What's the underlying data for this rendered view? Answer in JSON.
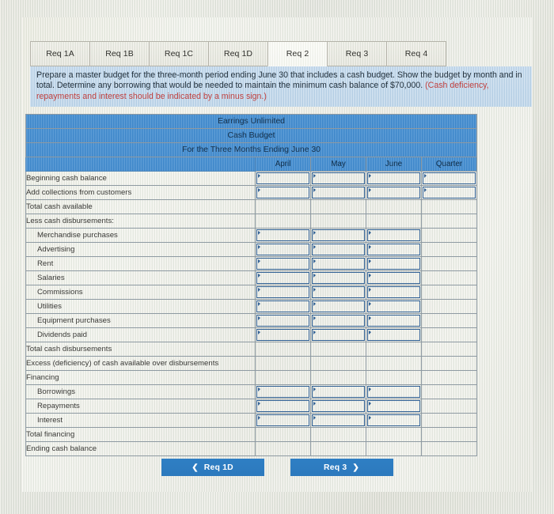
{
  "tabs": [
    {
      "label": "Req 1A",
      "active": false
    },
    {
      "label": "Req 1B",
      "active": false
    },
    {
      "label": "Req 1C",
      "active": false
    },
    {
      "label": "Req 1D",
      "active": false
    },
    {
      "label": "Req 2",
      "active": true
    },
    {
      "label": "Req 3",
      "active": false
    },
    {
      "label": "Req 4",
      "active": false
    }
  ],
  "instructions": {
    "main": "Prepare a master budget for the three-month period ending June 30 that includes a cash budget. Show the budget by month and in total. Determine any borrowing that would be needed to maintain the minimum cash balance of $70,000.",
    "hint": "(Cash deficiency, repayments and interest should be indicated by a minus sign.)"
  },
  "table": {
    "title_line1": "Earrings Unlimited",
    "title_line2": "Cash Budget",
    "title_line3": "For the Three Months Ending June 30",
    "columns": [
      "April",
      "May",
      "June",
      "Quarter"
    ],
    "rows": [
      {
        "label": "Beginning cash balance",
        "indent": false,
        "inputs": [
          true,
          true,
          true,
          true
        ]
      },
      {
        "label": "Add collections from customers",
        "indent": false,
        "inputs": [
          true,
          true,
          true,
          true
        ]
      },
      {
        "label": "Total cash available",
        "indent": false,
        "inputs": [
          false,
          false,
          false,
          false
        ]
      },
      {
        "label": "Less cash disbursements:",
        "indent": false,
        "inputs": [
          false,
          false,
          false,
          false
        ]
      },
      {
        "label": "Merchandise purchases",
        "indent": true,
        "inputs": [
          true,
          true,
          true,
          false
        ]
      },
      {
        "label": "Advertising",
        "indent": true,
        "inputs": [
          true,
          true,
          true,
          false
        ]
      },
      {
        "label": "Rent",
        "indent": true,
        "inputs": [
          true,
          true,
          true,
          false
        ]
      },
      {
        "label": "Salaries",
        "indent": true,
        "inputs": [
          true,
          true,
          true,
          false
        ]
      },
      {
        "label": "Commissions",
        "indent": true,
        "inputs": [
          true,
          true,
          true,
          false
        ]
      },
      {
        "label": "Utilities",
        "indent": true,
        "inputs": [
          true,
          true,
          true,
          false
        ]
      },
      {
        "label": "Equipment purchases",
        "indent": true,
        "inputs": [
          true,
          true,
          true,
          false
        ]
      },
      {
        "label": "Dividends paid",
        "indent": true,
        "inputs": [
          true,
          true,
          true,
          false
        ]
      },
      {
        "label": "Total cash disbursements",
        "indent": false,
        "inputs": [
          false,
          false,
          false,
          false
        ]
      },
      {
        "label": "Excess (deficiency) of cash available over disbursements",
        "indent": false,
        "inputs": [
          false,
          false,
          false,
          false
        ]
      },
      {
        "label": "Financing",
        "indent": false,
        "inputs": [
          false,
          false,
          false,
          false
        ]
      },
      {
        "label": "Borrowings",
        "indent": true,
        "inputs": [
          true,
          true,
          true,
          false
        ]
      },
      {
        "label": "Repayments",
        "indent": true,
        "inputs": [
          true,
          true,
          true,
          false
        ]
      },
      {
        "label": "Interest",
        "indent": true,
        "inputs": [
          true,
          true,
          true,
          false
        ]
      },
      {
        "label": "Total financing",
        "indent": false,
        "inputs": [
          false,
          false,
          false,
          false
        ]
      },
      {
        "label": "Ending cash balance",
        "indent": false,
        "inputs": [
          false,
          false,
          false,
          false
        ]
      }
    ]
  },
  "nav": {
    "prev_label": "Req 1D",
    "prev_icon": "chevron-left-icon",
    "next_label": "Req 3",
    "next_icon": "chevron-right-icon"
  },
  "colors": {
    "header_blue": "#3f8bd0",
    "instruction_blue": "#c3d9ec",
    "button_blue": "#2f7fc4",
    "hint_red": "#c0413f",
    "input_border": "#2f5f93"
  }
}
